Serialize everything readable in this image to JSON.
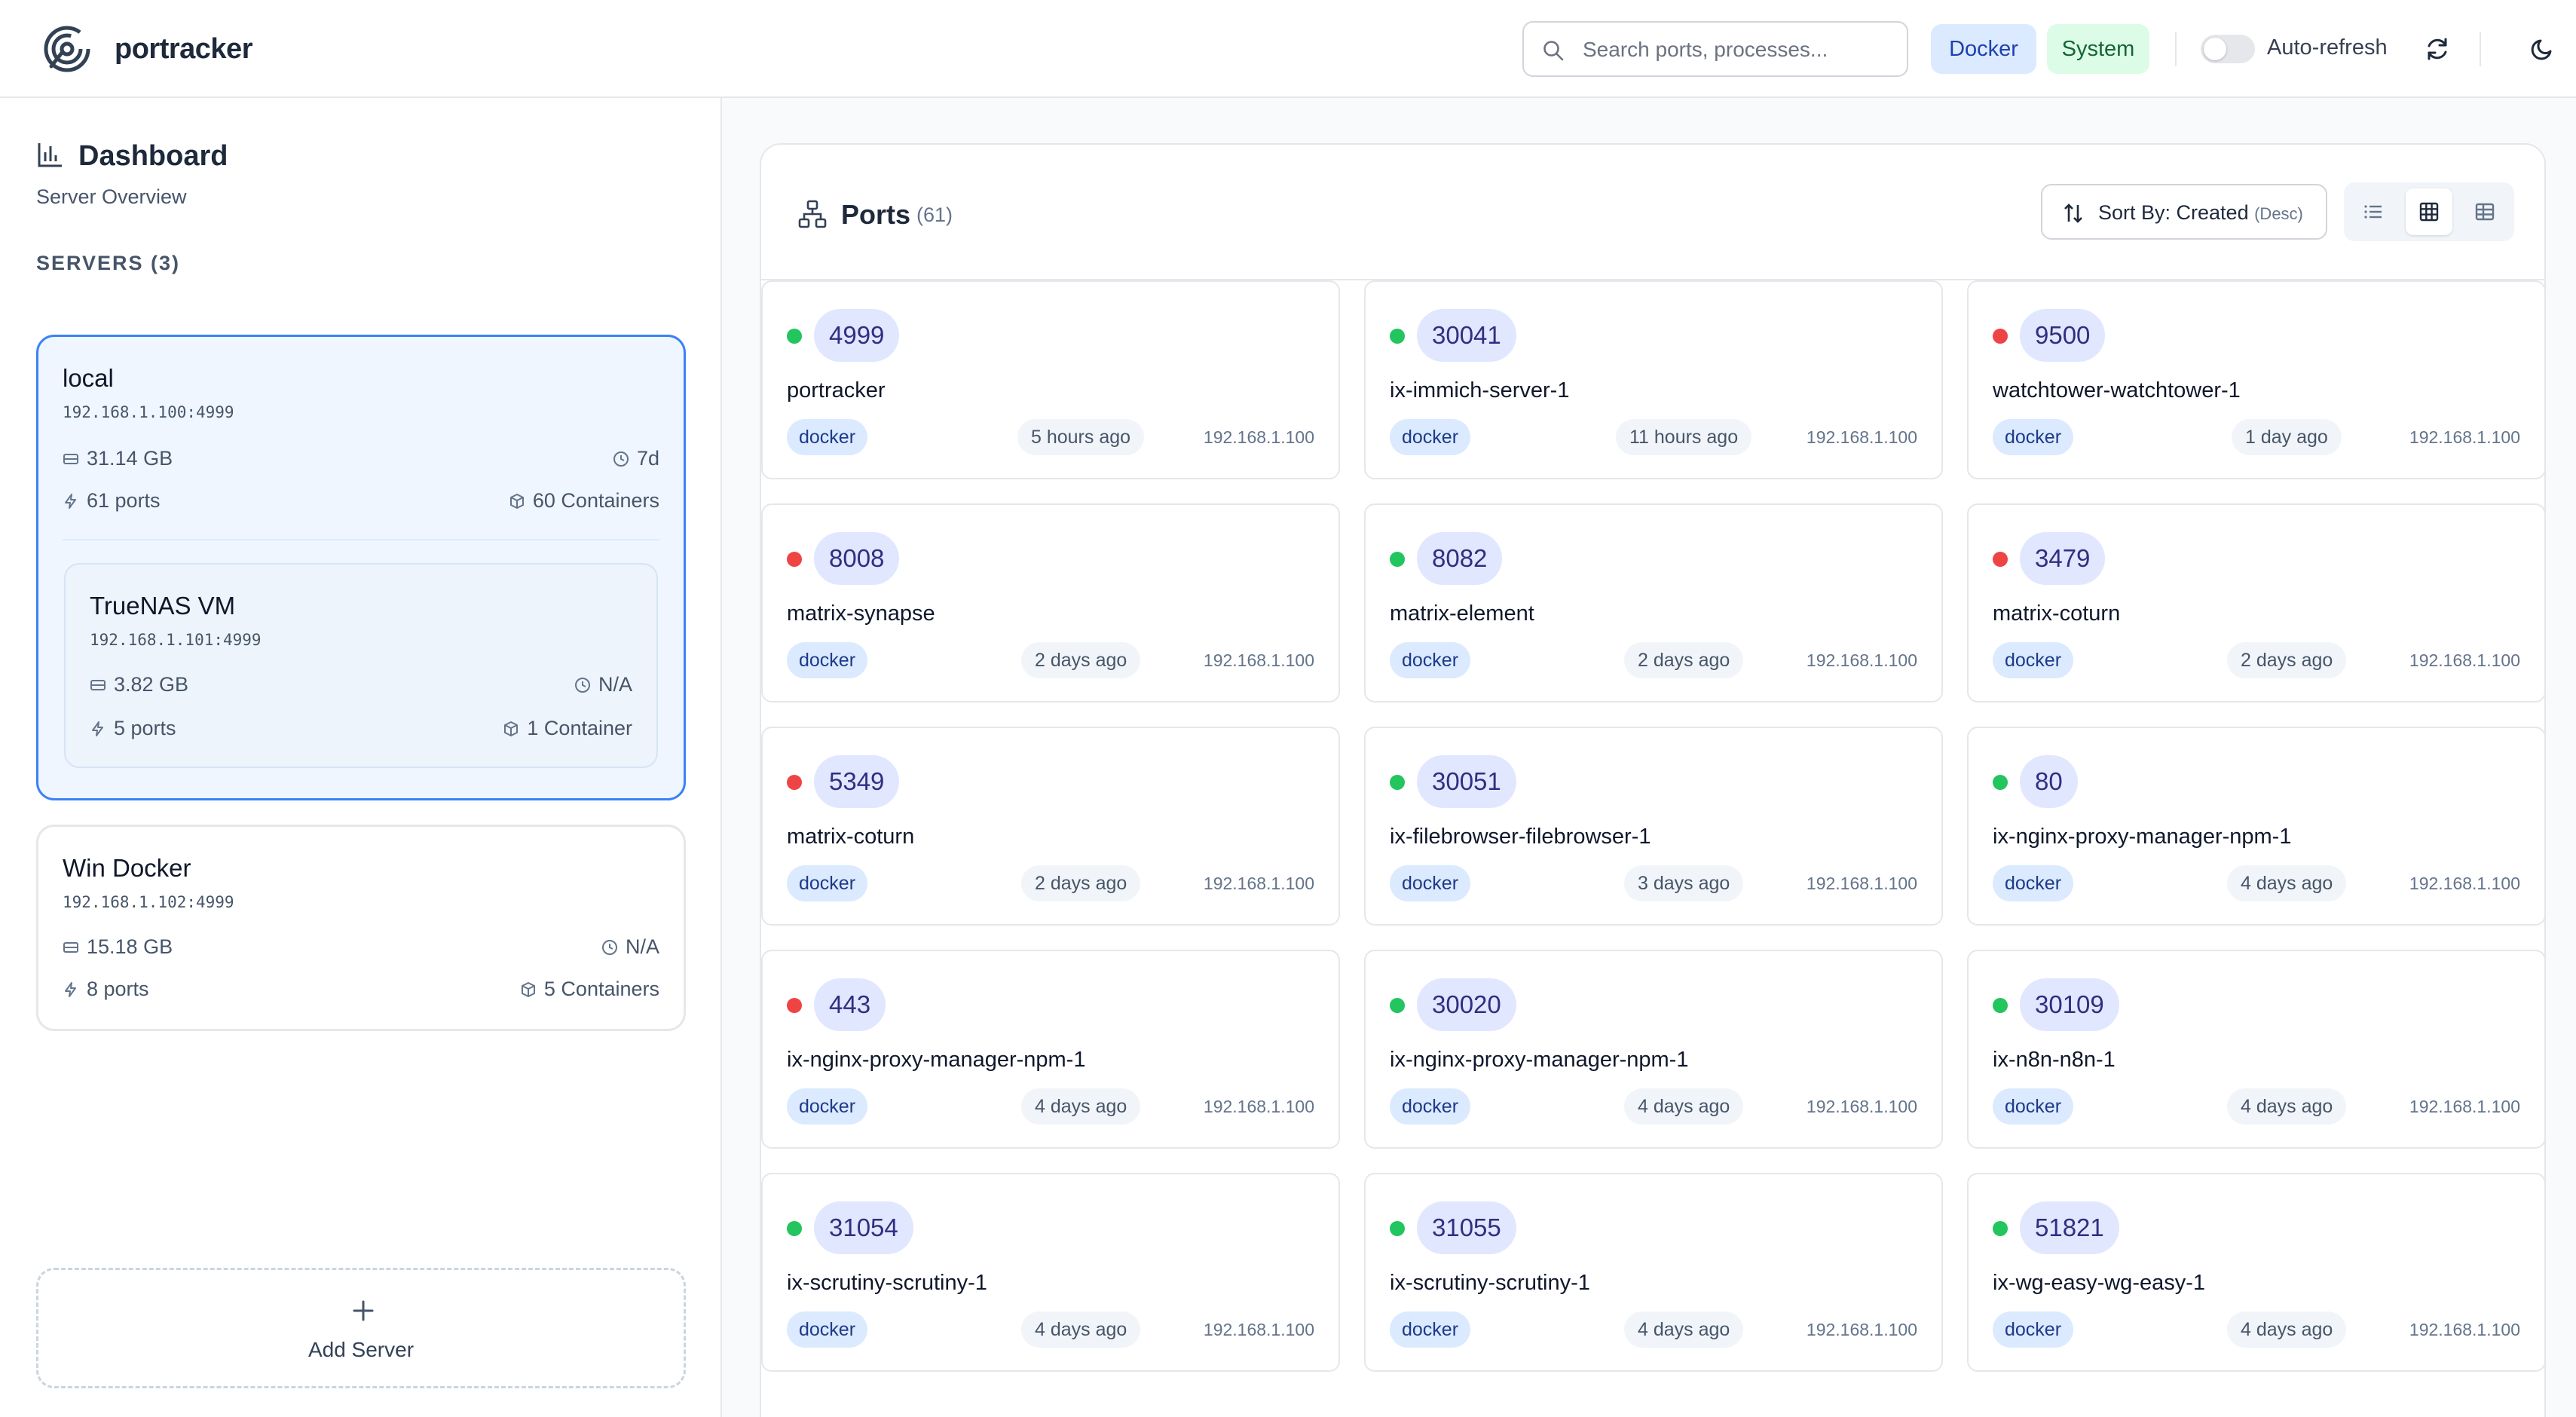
{
  "header": {
    "brand": "portracker",
    "search_placeholder": "Search ports, processes...",
    "filter_docker": "Docker",
    "filter_system": "System",
    "auto_refresh_label": "Auto-refresh"
  },
  "sidebar": {
    "title": "Dashboard",
    "subtitle": "Server Overview",
    "servers_label": "SERVERS (3)",
    "servers": [
      {
        "name": "local",
        "ip": "192.168.1.100:4999",
        "storage": "31.14 GB",
        "uptime": "7d",
        "ports": "61 ports",
        "containers": "60 Containers",
        "children": [
          {
            "name": "TrueNAS VM",
            "ip": "192.168.1.101:4999",
            "storage": "3.82 GB",
            "uptime": "N/A",
            "ports": "5 ports",
            "containers": "1 Container"
          }
        ]
      },
      {
        "name": "Win Docker",
        "ip": "192.168.1.102:4999",
        "storage": "15.18 GB",
        "uptime": "N/A",
        "ports": "8 ports",
        "containers": "5 Containers"
      }
    ],
    "add_server_label": "Add Server"
  },
  "main": {
    "title": "Ports",
    "count": "(61)",
    "sort_label": "Sort By: Created",
    "sort_dir": "(Desc)",
    "cards": [
      {
        "port": "4999",
        "status": "up",
        "process": "portracker",
        "source": "docker",
        "time": "5 hours ago",
        "host": "192.168.1.100"
      },
      {
        "port": "30041",
        "status": "up",
        "process": "ix-immich-server-1",
        "source": "docker",
        "time": "11 hours ago",
        "host": "192.168.1.100"
      },
      {
        "port": "9500",
        "status": "down",
        "process": "watchtower-watchtower-1",
        "source": "docker",
        "time": "1 day ago",
        "host": "192.168.1.100"
      },
      {
        "port": "8008",
        "status": "down",
        "process": "matrix-synapse",
        "source": "docker",
        "time": "2 days ago",
        "host": "192.168.1.100"
      },
      {
        "port": "8082",
        "status": "up",
        "process": "matrix-element",
        "source": "docker",
        "time": "2 days ago",
        "host": "192.168.1.100"
      },
      {
        "port": "3479",
        "status": "down",
        "process": "matrix-coturn",
        "source": "docker",
        "time": "2 days ago",
        "host": "192.168.1.100"
      },
      {
        "port": "5349",
        "status": "down",
        "process": "matrix-coturn",
        "source": "docker",
        "time": "2 days ago",
        "host": "192.168.1.100"
      },
      {
        "port": "30051",
        "status": "up",
        "process": "ix-filebrowser-filebrowser-1",
        "source": "docker",
        "time": "3 days ago",
        "host": "192.168.1.100"
      },
      {
        "port": "80",
        "status": "up",
        "process": "ix-nginx-proxy-manager-npm-1",
        "source": "docker",
        "time": "4 days ago",
        "host": "192.168.1.100"
      },
      {
        "port": "443",
        "status": "down",
        "process": "ix-nginx-proxy-manager-npm-1",
        "source": "docker",
        "time": "4 days ago",
        "host": "192.168.1.100"
      },
      {
        "port": "30020",
        "status": "up",
        "process": "ix-nginx-proxy-manager-npm-1",
        "source": "docker",
        "time": "4 days ago",
        "host": "192.168.1.100"
      },
      {
        "port": "30109",
        "status": "up",
        "process": "ix-n8n-n8n-1",
        "source": "docker",
        "time": "4 days ago",
        "host": "192.168.1.100"
      },
      {
        "port": "31054",
        "status": "up",
        "process": "ix-scrutiny-scrutiny-1",
        "source": "docker",
        "time": "4 days ago",
        "host": "192.168.1.100"
      },
      {
        "port": "31055",
        "status": "up",
        "process": "ix-scrutiny-scrutiny-1",
        "source": "docker",
        "time": "4 days ago",
        "host": "192.168.1.100"
      },
      {
        "port": "51821",
        "status": "up",
        "process": "ix-wg-easy-wg-easy-1",
        "source": "docker",
        "time": "4 days ago",
        "host": "192.168.1.100"
      }
    ]
  },
  "colors": {
    "accent": "#3b82f6",
    "status_up": "#22c55e",
    "status_down": "#ef4444"
  }
}
